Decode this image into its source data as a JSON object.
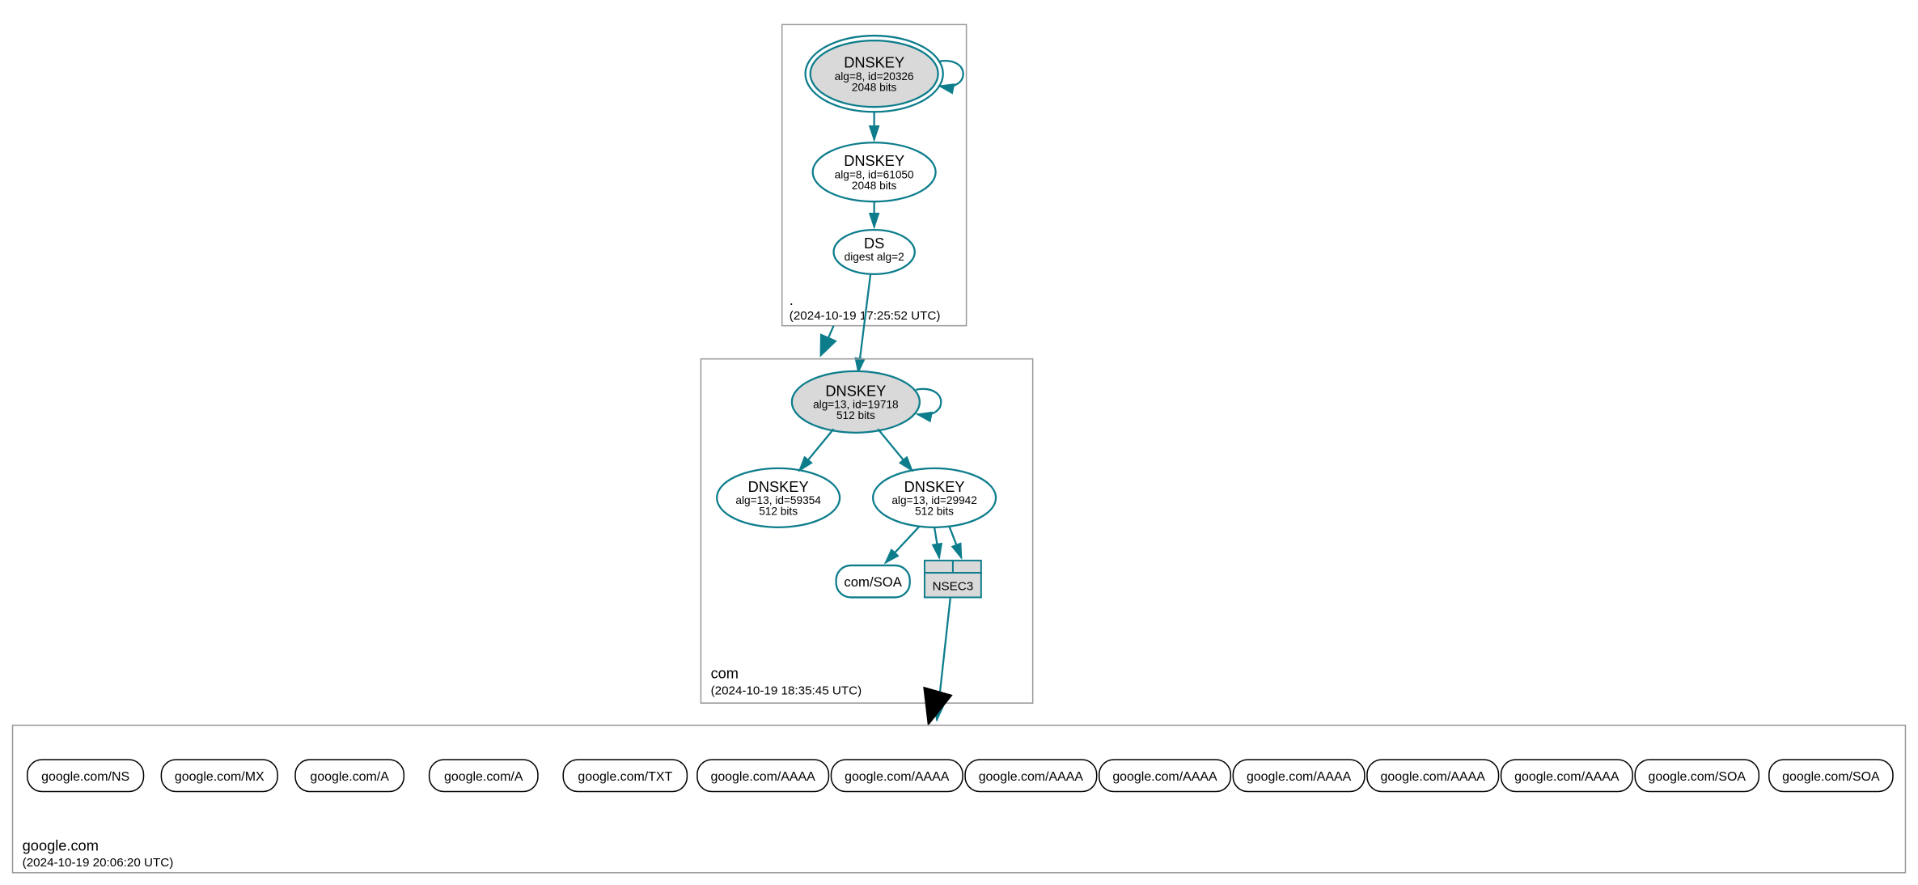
{
  "root_zone": {
    "label": ".",
    "timestamp": "(2024-10-19 17:25:52 UTC)",
    "ksk": {
      "title": "DNSKEY",
      "alg": "alg=8, id=20326",
      "bits": "2048 bits"
    },
    "zsk": {
      "title": "DNSKEY",
      "alg": "alg=8, id=61050",
      "bits": "2048 bits"
    },
    "ds": {
      "title": "DS",
      "digest": "digest alg=2"
    }
  },
  "com_zone": {
    "label": "com",
    "timestamp": "(2024-10-19 18:35:45 UTC)",
    "ksk": {
      "title": "DNSKEY",
      "alg": "alg=13, id=19718",
      "bits": "512 bits"
    },
    "zsk1": {
      "title": "DNSKEY",
      "alg": "alg=13, id=59354",
      "bits": "512 bits"
    },
    "zsk2": {
      "title": "DNSKEY",
      "alg": "alg=13, id=29942",
      "bits": "512 bits"
    },
    "soa": {
      "label": "com/SOA"
    },
    "nsec3": {
      "label": "NSEC3"
    }
  },
  "google_zone": {
    "label": "google.com",
    "timestamp": "(2024-10-19 20:06:20 UTC)",
    "rrsets": [
      "google.com/NS",
      "google.com/MX",
      "google.com/A",
      "google.com/A",
      "google.com/TXT",
      "google.com/AAAA",
      "google.com/AAAA",
      "google.com/AAAA",
      "google.com/AAAA",
      "google.com/AAAA",
      "google.com/AAAA",
      "google.com/AAAA",
      "google.com/SOA",
      "google.com/SOA"
    ]
  },
  "colors": {
    "teal": "#0d7d8c",
    "grey_fill": "#d9d9d9"
  }
}
